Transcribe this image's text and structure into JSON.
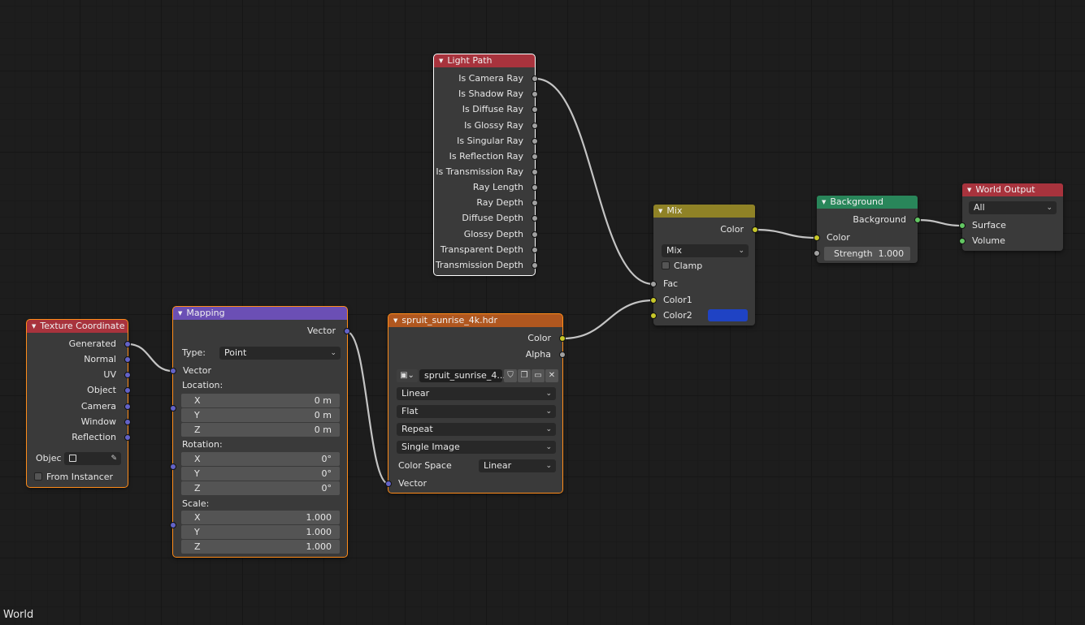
{
  "editor": {
    "context_label": "World"
  },
  "nodes": {
    "light_path": {
      "title": "Light Path",
      "outputs": [
        "Is Camera Ray",
        "Is Shadow Ray",
        "Is Diffuse Ray",
        "Is Glossy Ray",
        "Is Singular Ray",
        "Is Reflection Ray",
        "Is Transmission Ray",
        "Ray Length",
        "Ray Depth",
        "Diffuse Depth",
        "Glossy Depth",
        "Transparent Depth",
        "Transmission Depth"
      ]
    },
    "texture_coordinate": {
      "title": "Texture Coordinate",
      "outputs": [
        "Generated",
        "Normal",
        "UV",
        "Object",
        "Camera",
        "Window",
        "Reflection"
      ],
      "object_label": "Objec",
      "from_instancer_label": "From Instancer"
    },
    "mapping": {
      "title": "Mapping",
      "output_vector": "Vector",
      "type_label": "Type:",
      "type_value": "Point",
      "input_vector": "Vector",
      "location_label": "Location:",
      "location": [
        {
          "axis": "X",
          "value": "0 m"
        },
        {
          "axis": "Y",
          "value": "0 m"
        },
        {
          "axis": "Z",
          "value": "0 m"
        }
      ],
      "rotation_label": "Rotation:",
      "rotation": [
        {
          "axis": "X",
          "value": "0°"
        },
        {
          "axis": "Y",
          "value": "0°"
        },
        {
          "axis": "Z",
          "value": "0°"
        }
      ],
      "scale_label": "Scale:",
      "scale": [
        {
          "axis": "X",
          "value": "1.000"
        },
        {
          "axis": "Y",
          "value": "1.000"
        },
        {
          "axis": "Z",
          "value": "1.000"
        }
      ]
    },
    "env_texture": {
      "title": "spruit_sunrise_4k.hdr",
      "out_color": "Color",
      "out_alpha": "Alpha",
      "image_name": "spruit_sunrise_4...",
      "interpolation": "Linear",
      "projection": "Flat",
      "extension": "Repeat",
      "source": "Single Image",
      "color_space_label": "Color Space",
      "color_space_value": "Linear",
      "in_vector": "Vector"
    },
    "mix": {
      "title": "Mix",
      "out_color": "Color",
      "blend_type": "Mix",
      "clamp_label": "Clamp",
      "in_fac": "Fac",
      "in_color1": "Color1",
      "in_color2": "Color2",
      "color2_swatch": "#1f43c4"
    },
    "background": {
      "title": "Background",
      "out_background": "Background",
      "in_color": "Color",
      "strength_label": "Strength",
      "strength_value": "1.000"
    },
    "world_output": {
      "title": "World Output",
      "target": "All",
      "in_surface": "Surface",
      "in_volume": "Volume"
    }
  },
  "colors": {
    "header_input": "#a8333d",
    "header_converter": "#6b4fb5",
    "header_texture": "#b0571f",
    "header_color": "#8f8226",
    "header_shader": "#29865a",
    "header_output": "#a8333d",
    "socket_vector": "#6363c7",
    "socket_color": "#c7c729",
    "socket_float": "#a1a1a1",
    "socket_shader": "#63c763",
    "selected_outline": "#ff8c1a"
  }
}
